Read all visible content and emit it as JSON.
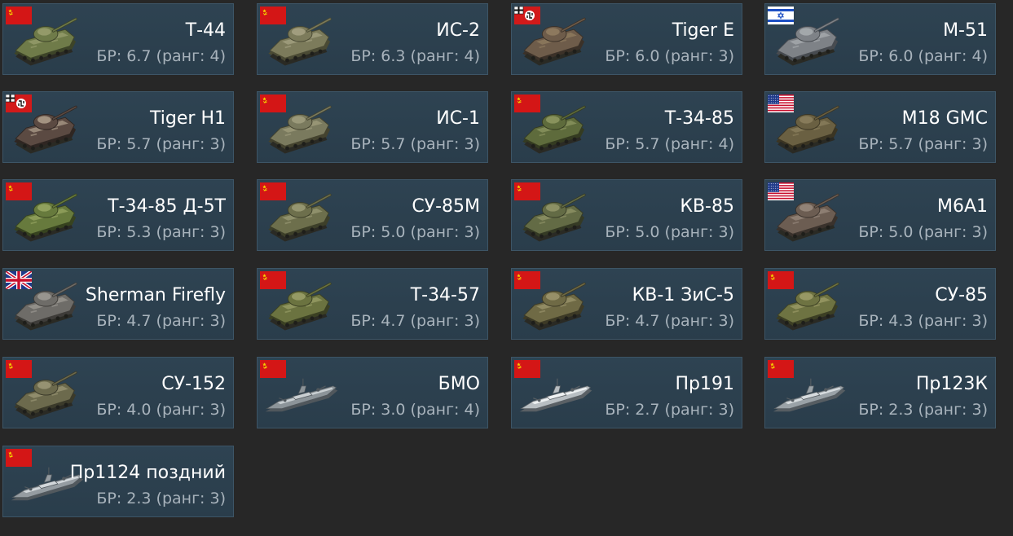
{
  "br_label": "БР:",
  "rank_label": "ранг:",
  "vehicles": [
    {
      "name": "Т-44",
      "br": "6.7",
      "rank": "4",
      "nation": "ussr",
      "kind": "tank",
      "camo": [
        "#6f7b49",
        "#a4a878",
        "#3d4428"
      ]
    },
    {
      "name": "ИС-2",
      "br": "6.3",
      "rank": "4",
      "nation": "ussr",
      "kind": "tank",
      "camo": [
        "#7c7b5b",
        "#b1ad8d",
        "#4a4a34"
      ]
    },
    {
      "name": "Tiger E",
      "br": "6.0",
      "rank": "3",
      "nation": "germany",
      "kind": "tank",
      "camo": [
        "#6e5c4a",
        "#9a8666",
        "#3b3128"
      ]
    },
    {
      "name": "M-51",
      "br": "6.0",
      "rank": "4",
      "nation": "israel",
      "kind": "tank",
      "camo": [
        "#7e8287",
        "#b4b8bb",
        "#474b50"
      ]
    },
    {
      "name": "Tiger H1",
      "br": "5.7",
      "rank": "3",
      "nation": "germany",
      "kind": "tank",
      "camo": [
        "#5b4a42",
        "#c2b29c",
        "#2f2622"
      ]
    },
    {
      "name": "ИС-1",
      "br": "5.7",
      "rank": "3",
      "nation": "ussr",
      "kind": "tank",
      "camo": [
        "#7a7a5e",
        "#aaa686",
        "#44432f"
      ]
    },
    {
      "name": "Т-34-85",
      "br": "5.7",
      "rank": "4",
      "nation": "ussr",
      "kind": "tank",
      "camo": [
        "#5e6b3c",
        "#9aa26a",
        "#343b21"
      ]
    },
    {
      "name": "M18 GMC",
      "br": "5.7",
      "rank": "3",
      "nation": "usa",
      "kind": "tank",
      "camo": [
        "#6a6042",
        "#948865",
        "#3b3523"
      ]
    },
    {
      "name": "Т-34-85 Д-5Т",
      "br": "5.3",
      "rank": "3",
      "nation": "ussr",
      "kind": "tank",
      "camo": [
        "#677a3d",
        "#a3b06b",
        "#37431f"
      ]
    },
    {
      "name": "СУ-85М",
      "br": "5.0",
      "rank": "3",
      "nation": "ussr",
      "kind": "tank",
      "camo": [
        "#6d6f4c",
        "#a7a680",
        "#3d3f29"
      ]
    },
    {
      "name": "КВ-85",
      "br": "5.0",
      "rank": "3",
      "nation": "ussr",
      "kind": "tank",
      "camo": [
        "#636b45",
        "#9ea072",
        "#353a25"
      ]
    },
    {
      "name": "M6A1",
      "br": "5.0",
      "rank": "3",
      "nation": "usa",
      "kind": "tank",
      "camo": [
        "#6c5d52",
        "#a39488",
        "#3a322c"
      ]
    },
    {
      "name": "Sherman Firefly",
      "br": "4.7",
      "rank": "3",
      "nation": "uk",
      "kind": "tank",
      "camo": [
        "#6e6c68",
        "#aaa7a0",
        "#3e3c39"
      ]
    },
    {
      "name": "Т-34-57",
      "br": "4.7",
      "rank": "3",
      "nation": "ussr",
      "kind": "tank",
      "camo": [
        "#6b7340",
        "#a6ab73",
        "#3b4023"
      ]
    },
    {
      "name": "КВ-1 ЗиС-5",
      "br": "4.7",
      "rank": "3",
      "nation": "ussr",
      "kind": "tank",
      "camo": [
        "#6f6a45",
        "#a8a178",
        "#3d3a26"
      ]
    },
    {
      "name": "СУ-85",
      "br": "4.3",
      "rank": "3",
      "nation": "ussr",
      "kind": "tank",
      "camo": [
        "#6e7342",
        "#aaa873",
        "#3c3f24"
      ]
    },
    {
      "name": "СУ-152",
      "br": "4.0",
      "rank": "3",
      "nation": "ussr",
      "kind": "tank",
      "camo": [
        "#6c6a4d",
        "#a8a482",
        "#3b3a2a"
      ]
    },
    {
      "name": "БМО",
      "br": "3.0",
      "rank": "4",
      "nation": "ussr",
      "kind": "ship",
      "camo": [
        "#8c9499",
        "#c9cfd2",
        "#50575c"
      ]
    },
    {
      "name": "Пр191",
      "br": "2.7",
      "rank": "3",
      "nation": "ussr",
      "kind": "ship",
      "camo": [
        "#b8bec2",
        "#eef1f2",
        "#5a6065"
      ]
    },
    {
      "name": "Пр123К",
      "br": "2.3",
      "rank": "3",
      "nation": "ussr",
      "kind": "ship",
      "camo": [
        "#9aa2a7",
        "#d7dcdf",
        "#565d62"
      ]
    },
    {
      "name": "Пр1124 поздний",
      "br": "2.3",
      "rank": "3",
      "nation": "ussr",
      "kind": "ship",
      "camo": [
        "#959ca1",
        "#d2d7da",
        "#52595e"
      ]
    }
  ]
}
